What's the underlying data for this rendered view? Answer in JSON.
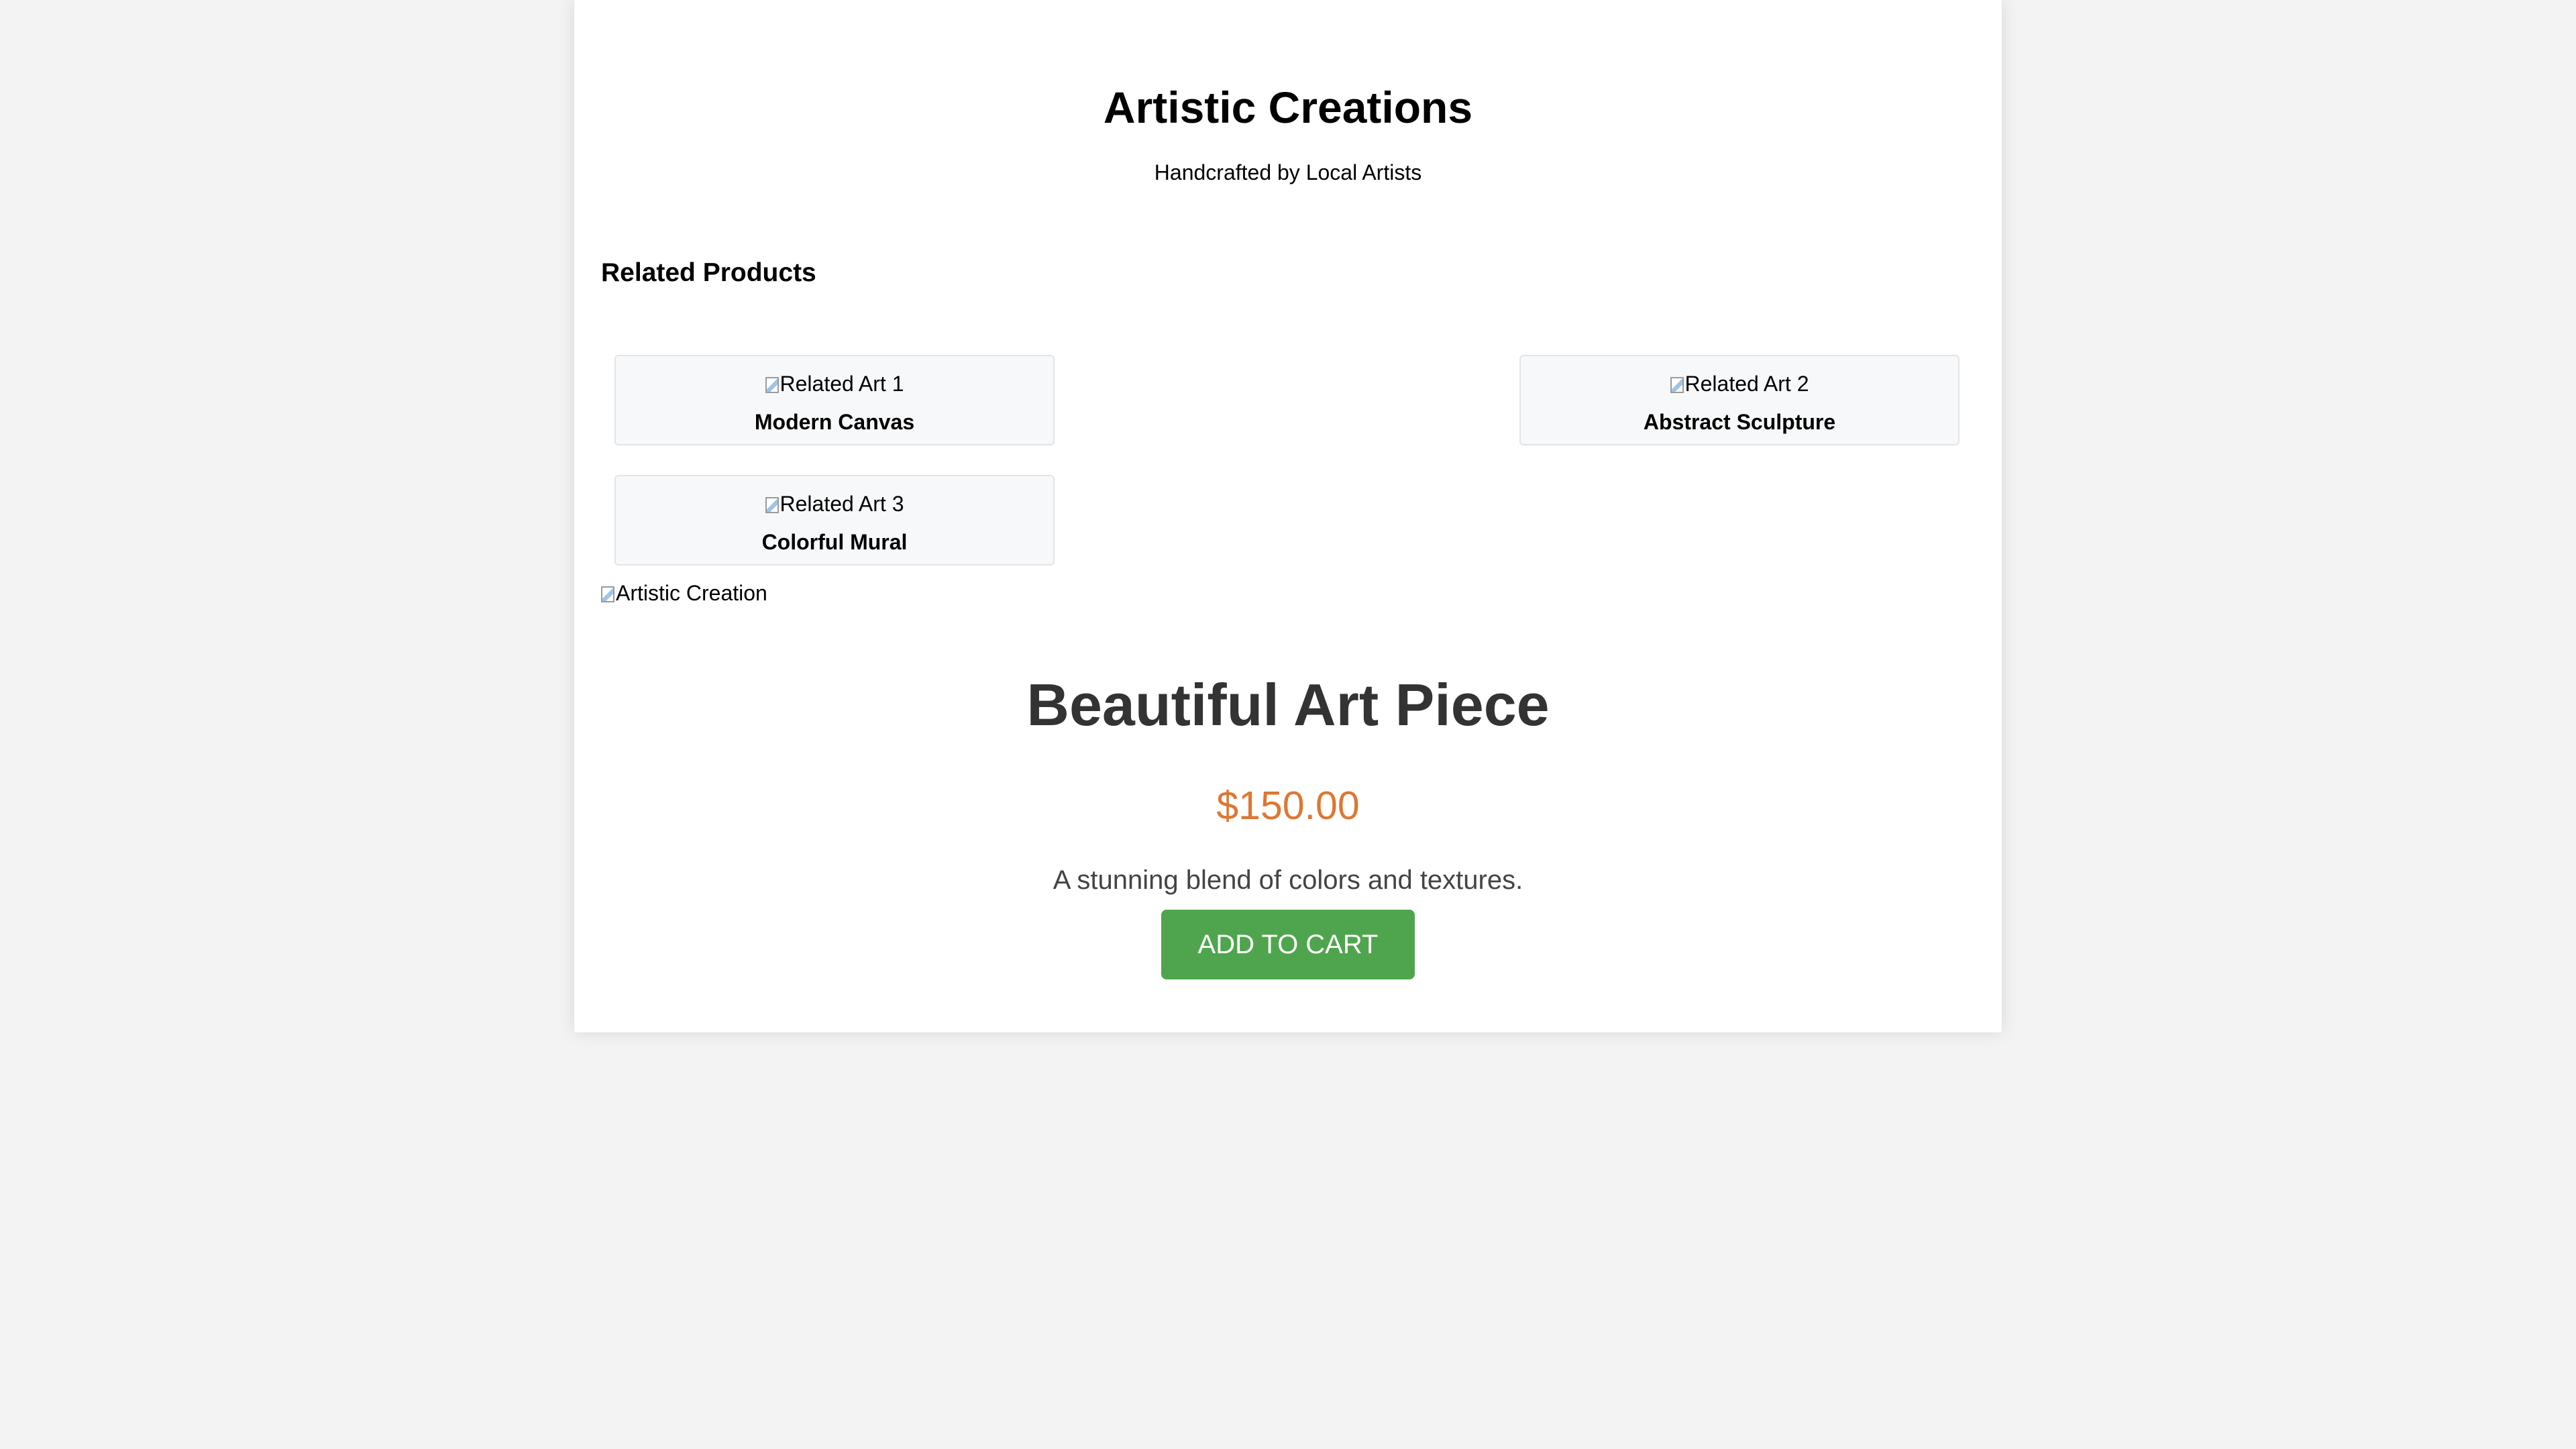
{
  "header": {
    "title": "Artistic Creations",
    "subtitle": "Handcrafted by Local Artists"
  },
  "related": {
    "heading": "Related Products",
    "items": [
      {
        "image_alt": "Related Art 1",
        "title": "Modern Canvas"
      },
      {
        "image_alt": "Related Art 2",
        "title": "Abstract Sculpture"
      },
      {
        "image_alt": "Related Art 3",
        "title": "Colorful Mural"
      }
    ]
  },
  "product": {
    "image_alt": "Artistic Creation",
    "title": "Beautiful Art Piece",
    "price": "$150.00",
    "description": "A stunning blend of colors and textures.",
    "add_to_cart_label": "ADD TO CART"
  },
  "colors": {
    "page_background": "#f3f3f3",
    "content_background": "#ffffff",
    "price": "#dd7733",
    "button": "#4fa54e",
    "card_background": "#f7f8fa"
  },
  "icons": {
    "image_placeholder": "broken-image-icon"
  }
}
